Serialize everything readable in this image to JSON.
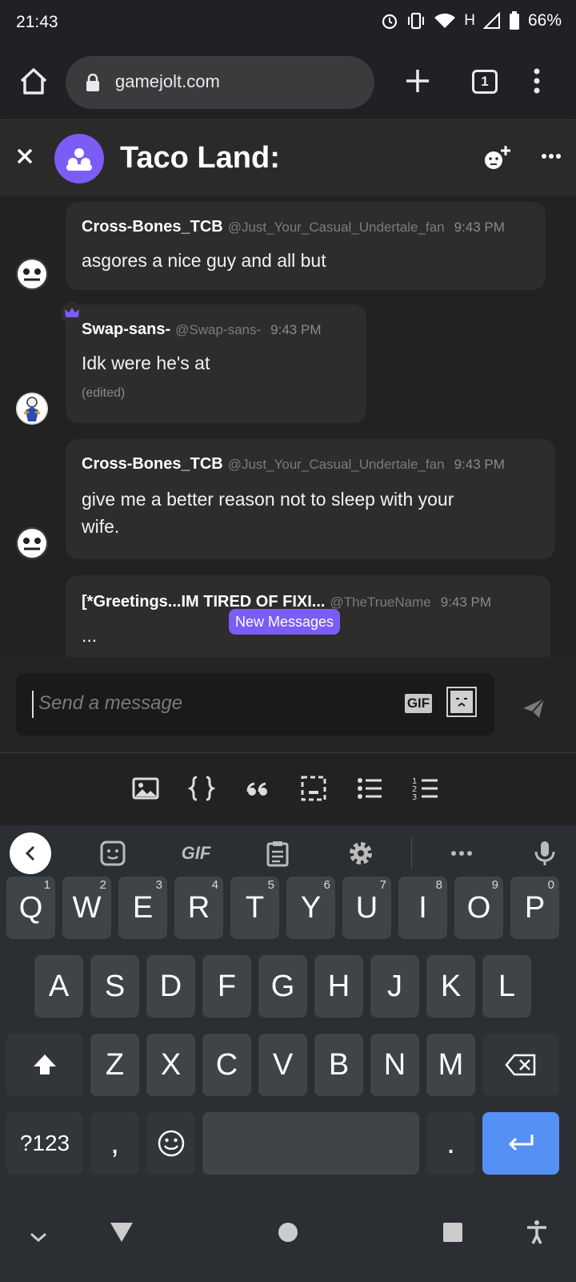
{
  "status_bar": {
    "time": "21:43",
    "network": "H",
    "battery": "66%"
  },
  "browser": {
    "url": "gamejolt.com",
    "tab_count": "1"
  },
  "chat": {
    "room_title": "Taco Land:"
  },
  "messages": [
    {
      "user": "Cross-Bones_TCB",
      "handle": "@Just_Your_Casual_Undertale_fan",
      "time": "9:43 PM",
      "lines": [
        "asgores a nice guy and all but"
      ]
    },
    {
      "user": "Swap-sans-",
      "handle": "@Swap-sans-",
      "time": "9:43 PM",
      "lines": [
        "Idk were he's at"
      ],
      "edited": "(edited)"
    },
    {
      "user": "Cross-Bones_TCB",
      "handle": "@Just_Your_Casual_Undertale_fan",
      "time": "9:43 PM",
      "lines": [
        "give me a better reason not to sleep with your",
        "wife."
      ]
    },
    {
      "user": "[*Greetings...IM TIRED OF FIXI...",
      "handle": "@TheTrueName",
      "time": "9:43 PM",
      "lines": [
        "..."
      ]
    }
  ],
  "new_messages_label": "New Messages",
  "composer": {
    "placeholder": "Send a message",
    "gif_label": "GIF"
  },
  "keyboard": {
    "gif_label": "GIF",
    "row1": [
      {
        "k": "Q",
        "h": "1"
      },
      {
        "k": "W",
        "h": "2"
      },
      {
        "k": "E",
        "h": "3"
      },
      {
        "k": "R",
        "h": "4"
      },
      {
        "k": "T",
        "h": "5"
      },
      {
        "k": "Y",
        "h": "6"
      },
      {
        "k": "U",
        "h": "7"
      },
      {
        "k": "I",
        "h": "8"
      },
      {
        "k": "O",
        "h": "9"
      },
      {
        "k": "P",
        "h": "0"
      }
    ],
    "row2": [
      "A",
      "S",
      "D",
      "F",
      "G",
      "H",
      "J",
      "K",
      "L"
    ],
    "row3": [
      "Z",
      "X",
      "C",
      "V",
      "B",
      "N",
      "M"
    ],
    "symbols": "?123",
    "comma": ",",
    "period": "."
  },
  "icons": {
    "home": "home-icon",
    "lock": "lock-icon",
    "new_tab": "plus-icon",
    "menu": "more-vert-icon",
    "close": "close-icon",
    "add_member": "add-member-icon",
    "more": "more-horiz-icon",
    "send": "send-icon",
    "crown": "crown-icon"
  },
  "colors": {
    "accent": "#7b5cf5",
    "enter_key": "#5591f5"
  }
}
